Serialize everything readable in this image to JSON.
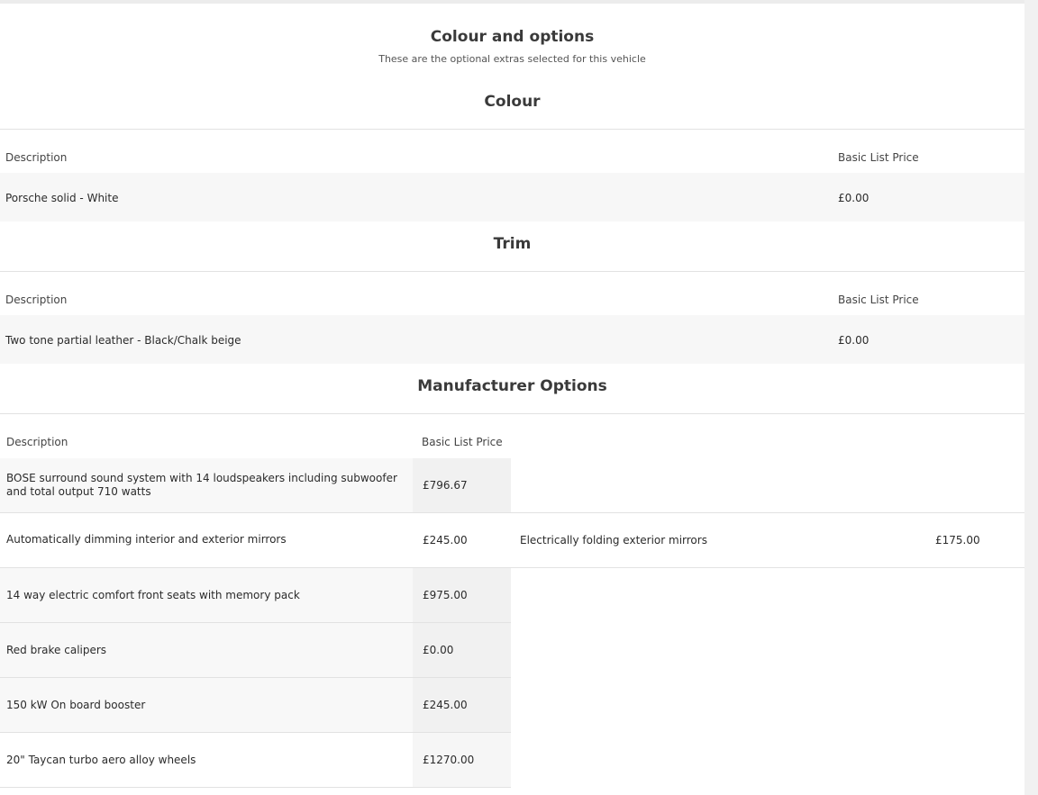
{
  "header": {
    "title": "Colour and options",
    "subtitle": "These are the optional extras selected for this vehicle"
  },
  "colour": {
    "title": "Colour",
    "col_description": "Description",
    "col_price": "Basic List Price",
    "rows": [
      {
        "description": "Porsche solid - White",
        "price": "£0.00"
      }
    ]
  },
  "trim": {
    "title": "Trim",
    "col_description": "Description",
    "col_price": "Basic List Price",
    "rows": [
      {
        "description": "Two tone partial leather - Black/Chalk beige",
        "price": "£0.00"
      }
    ]
  },
  "manufacturer_options": {
    "title": "Manufacturer Options",
    "col_description": "Description",
    "col_price": "Basic List Price",
    "rows": [
      {
        "description": "BOSE surround sound system with 14 loudspeakers including subwoofer and total output 710 watts",
        "price": "£796.67"
      },
      {
        "description": "Automatically dimming interior and exterior mirrors",
        "price": "£245.00"
      },
      {
        "description": "14 way electric comfort front seats with memory pack",
        "price": "£975.00"
      },
      {
        "description": "Red brake calipers",
        "price": "£0.00"
      },
      {
        "description": "150 kW On board booster",
        "price": "£245.00"
      },
      {
        "description": "20\" Taycan turbo aero alloy wheels",
        "price": "£1270.00"
      }
    ],
    "extra": {
      "description": "Electrically folding exterior mirrors",
      "price": "£175.00"
    }
  }
}
